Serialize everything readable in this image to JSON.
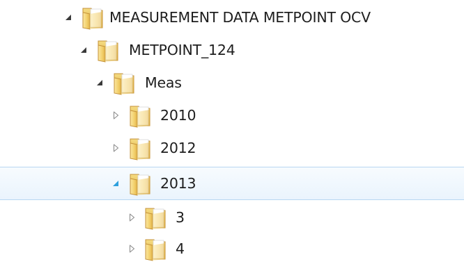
{
  "tree": {
    "root": {
      "label": "MEASUREMENT DATA METPOINT OCV",
      "expanded": true,
      "icon": "folder-icon"
    },
    "metpoint": {
      "label": "METPOINT_124",
      "expanded": true,
      "icon": "folder-icon"
    },
    "meas": {
      "label": "Meas",
      "expanded": true,
      "icon": "folder-icon"
    },
    "y2010": {
      "label": "2010",
      "expanded": false,
      "icon": "folder-icon"
    },
    "y2012": {
      "label": "2012",
      "expanded": false,
      "icon": "folder-icon"
    },
    "y2013": {
      "label": "2013",
      "expanded": true,
      "selected": true,
      "icon": "folder-icon"
    },
    "m3": {
      "label": "3",
      "expanded": false,
      "icon": "folder-icon"
    },
    "m4": {
      "label": "4",
      "expanded": false,
      "icon": "folder-icon"
    }
  },
  "colors": {
    "selection_fill": "#eaf4fd",
    "selection_border": "#b7d6f2",
    "expander_active": "#2ea0dd",
    "folder": "#e8c25a"
  }
}
